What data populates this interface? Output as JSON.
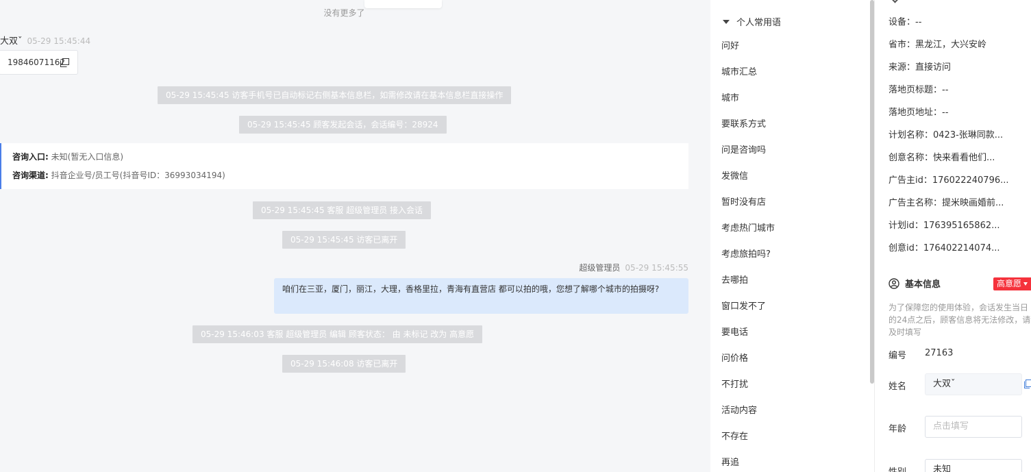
{
  "chat": {
    "no_more": "没有更多了",
    "visitor": {
      "name": "大双ˇ",
      "time": "05-29 15:45:44",
      "phone": "19846071162"
    },
    "notices": [
      "05-29 15:45:45 访客手机号已自动标记右侧基本信息栏，如需修改请在基本信息栏直接操作",
      "05-29 15:45:45 顾客发起会话，会话编号：28924",
      "05-29 15:45:45 客服 超级管理员 接入会话",
      "05-29 15:45:45 访客已离开",
      "05-29 15:46:03 客服 超级管理员 编辑 顾客状态： 由 未标记 改为 高意愿",
      "05-29 15:46:08 访客已离开"
    ],
    "consult": {
      "entry_label": "咨询入口:",
      "entry_value": "未知(暂无入口信息)",
      "channel_label": "咨询渠道:",
      "channel_value": "抖音企业号/员工号(抖音号ID：36993034194)"
    },
    "agent": {
      "name": "超级管理员",
      "time": "05-29 15:45:55",
      "message": "咱们在三亚，厦门，丽江，大理，香格里拉，青海有直营店 都可以拍的哦，您想了解哪个城市的拍摄呀?"
    }
  },
  "phrases": {
    "header": "个人常用语",
    "items": [
      "问好",
      "城市汇总",
      "城市",
      "要联系方式",
      "问是咨询吗",
      "发微信",
      "暂时没有店",
      "考虑热门城市",
      "考虑旅拍吗?",
      "去哪拍",
      "窗口发不了",
      "要电话",
      "问价格",
      "不打扰",
      "活动内容",
      "不存在",
      "再追"
    ]
  },
  "info": {
    "meta": [
      "设备：--",
      "省市：黑龙江，大兴安岭",
      "来源：直接访问",
      "落地页标题：--",
      "落地页地址：--",
      "计划名称：0423-张琳同款...",
      "创意名称：快来看看他们...",
      "广告主id：176022240796...",
      "广告主名称：提米映画婚前...",
      "计划id：176395165862...",
      "创意id：176402214074..."
    ],
    "section_title": "基本信息",
    "intent_badge": "高意愿",
    "notice": "为了保障您的使用体验，会话发生当日的24点之后，顾客信息将无法修改，请及时填写",
    "fields": {
      "id_label": "编号",
      "id_value": "27163",
      "name_label": "姓名",
      "name_value": "大双ˇ",
      "age_label": "年龄",
      "age_placeholder": "点击填写",
      "gender_label": "性别",
      "gender_value": "未知"
    }
  },
  "colors": {
    "accent_blue": "#4a7ee8",
    "agent_bubble": "#dbe9fc",
    "notice_bg": "#d9dadd",
    "badge_red": "#f5323c"
  },
  "icons": [
    "copy-icon",
    "caret-down-icon",
    "user-circle-icon",
    "chevron-down-icon",
    "dropdown-arrow-icon"
  ]
}
